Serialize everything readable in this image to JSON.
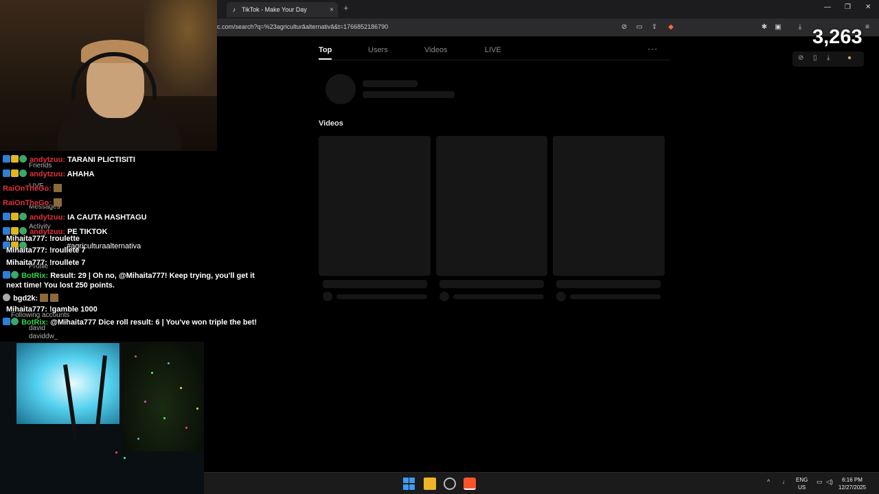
{
  "browser": {
    "tab_title": "TikTok - Make Your Day",
    "tab_close": "×",
    "new_tab": "+",
    "url": "c.com/search?q=%23agriculturăalternativă&t=1766852186790",
    "window": {
      "minimize": "—",
      "restore": "❐",
      "close": "✕"
    }
  },
  "tiktok": {
    "tabs": [
      "Top",
      "Users",
      "Videos",
      "LIVE"
    ],
    "active_tab": "Top",
    "more": "···",
    "videos_heading": "Videos"
  },
  "overlay": {
    "viewer_count": "3,263"
  },
  "chat": {
    "lines": [
      {
        "user": "andytzuu:",
        "text": "TARANI PLICTISITI",
        "color": "#e0303a"
      },
      {
        "user": "andytzuu:",
        "text": "AHAHA",
        "color": "#e0303a"
      },
      {
        "user": "RaiOnTheGo:",
        "text": "",
        "color": "#e0303a"
      },
      {
        "user": "RaiOnTheGo:",
        "text": "",
        "color": "#e0303a"
      },
      {
        "user": "andytzuu:",
        "text": "IA CAUTA HASHTAGU",
        "color": "#e0303a"
      },
      {
        "user": "andytzuu:",
        "text": "PE TIKTOK",
        "color": "#e0303a"
      },
      {
        "user": "",
        "text": "#agriculturaalternativa",
        "color": "#e0303a"
      },
      {
        "user": "Mihaita777:",
        "text": "!roulette",
        "color": "#ffffff"
      },
      {
        "user": "Mihaita777:",
        "text": "!roullete 7",
        "color": "#ffffff"
      },
      {
        "user": "Mihaita777:",
        "text": "!roullete 7",
        "color": "#ffffff"
      },
      {
        "user": "BotRix:",
        "text": "Result: 29 | Oh no, @Mihaita777! Keep trying, you'll get it",
        "color": "#2fd34a"
      },
      {
        "user": "",
        "text": "next time! You lost 250 points.",
        "color": "#ffffff"
      },
      {
        "user": "bgd2k:",
        "text": "",
        "color": "#ffffff"
      },
      {
        "user": "Mihaita777:",
        "text": "!gamble 1000",
        "color": "#ffffff"
      },
      {
        "user": "BotRix:",
        "text": "@Mihaita777 Dice roll result: 6 | You've won triple the bet!",
        "color": "#2fd34a"
      }
    ],
    "ghost_labels": [
      "Friends",
      "LIVE",
      "Messages",
      "Activity",
      "Profile",
      "Following accounts",
      "david",
      "daviddw_"
    ]
  },
  "taskbar": {
    "lang_top": "ENG",
    "lang_bottom": "US",
    "time": "6:16 PM",
    "date": "12/27/2025",
    "chevron": "^"
  }
}
